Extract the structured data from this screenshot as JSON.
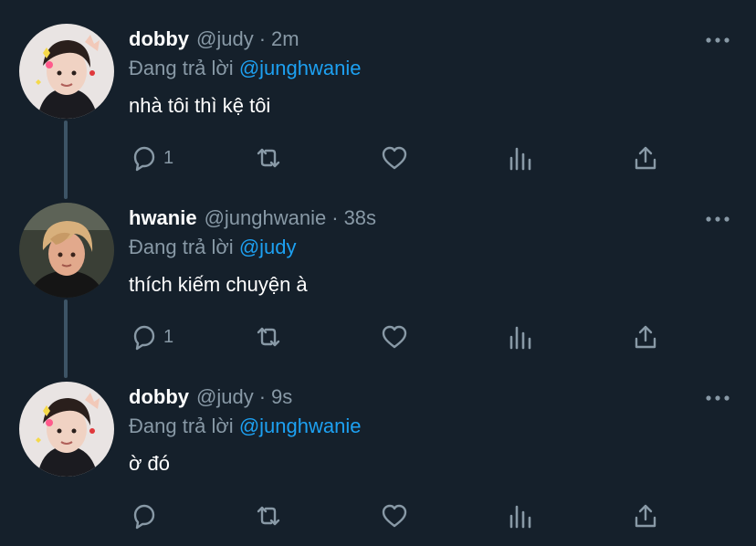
{
  "tweets": [
    {
      "name": "dobby",
      "handle": "@judy",
      "separator": "·",
      "time": "2m",
      "reply_prefix": "Đang trả lời",
      "reply_to": "@junghwanie",
      "text": "nhà tôi thì kệ tôi",
      "reply_count": "1"
    },
    {
      "name": "hwanie",
      "handle": "@junghwanie",
      "separator": "·",
      "time": "38s",
      "reply_prefix": "Đang trả lời",
      "reply_to": "@judy",
      "text": "thích kiếm chuyện à",
      "reply_count": "1"
    },
    {
      "name": "dobby",
      "handle": "@judy",
      "separator": "·",
      "time": "9s",
      "reply_prefix": "Đang trả lời",
      "reply_to": "@junghwanie",
      "text": "ờ đó",
      "reply_count": ""
    }
  ],
  "icons": {
    "more": "more-horizontal-icon",
    "reply": "reply-bubble-icon",
    "retweet": "retweet-icon",
    "like": "heart-icon",
    "analytics": "analytics-bars-icon",
    "share": "share-upload-icon"
  },
  "colors": {
    "background": "#15202b",
    "text": "#ffffff",
    "secondary": "#8899a6",
    "link": "#1da1f2",
    "thread_line": "#3d5466"
  }
}
